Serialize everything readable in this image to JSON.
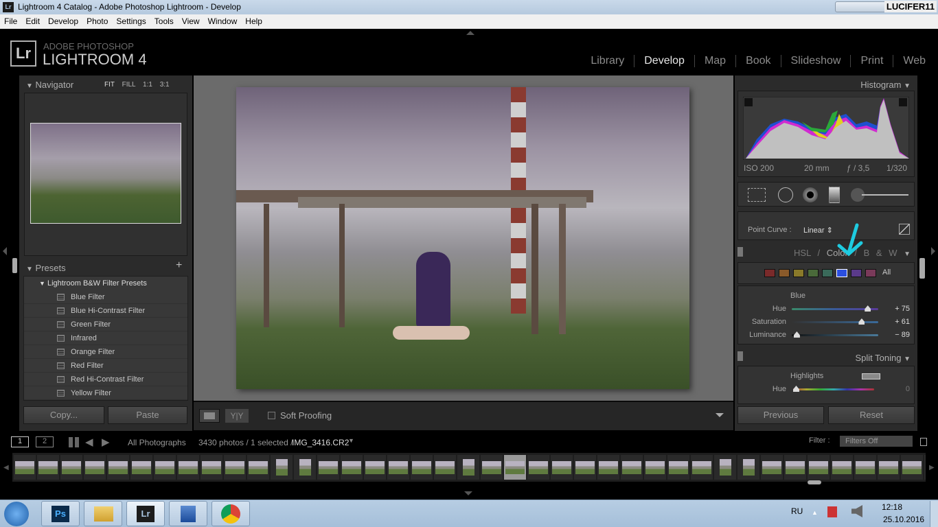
{
  "window": {
    "title": "Lightroom 4 Catalog - Adobe Photoshop Lightroom - Develop",
    "app_icon": "Lr",
    "user": "LUCIFER11"
  },
  "menu": [
    "File",
    "Edit",
    "Develop",
    "Photo",
    "Settings",
    "Tools",
    "View",
    "Window",
    "Help"
  ],
  "brand": {
    "logo": "Lr",
    "line1": "ADOBE PHOTOSHOP",
    "line2": "LIGHTROOM 4"
  },
  "modules": [
    {
      "label": "Library"
    },
    {
      "label": "Develop",
      "active": true
    },
    {
      "label": "Map"
    },
    {
      "label": "Book"
    },
    {
      "label": "Slideshow"
    },
    {
      "label": "Print"
    },
    {
      "label": "Web"
    }
  ],
  "navigator": {
    "title": "Navigator",
    "zoom": [
      "FIT",
      "FILL",
      "1:1",
      "3:1"
    ],
    "active_zoom": "FIT"
  },
  "presets": {
    "title": "Presets",
    "add": "+",
    "folder": "Lightroom B&W Filter Presets",
    "items": [
      "Blue Filter",
      "Blue Hi-Contrast Filter",
      "Green Filter",
      "Infrared",
      "Orange Filter",
      "Red Filter",
      "Red Hi-Contrast Filter",
      "Yellow Filter"
    ]
  },
  "left_buttons": {
    "copy": "Copy...",
    "paste": "Paste"
  },
  "toolbar": {
    "soft_proofing": "Soft Proofing",
    "soft_proofing_checked": false
  },
  "histogram": {
    "title": "Histogram",
    "iso": "ISO 200",
    "focal": "20 mm",
    "aperture": "ƒ / 3,5",
    "shutter": "1/320"
  },
  "tone_curve": {
    "label": "Point Curve :",
    "value": "Linear"
  },
  "hsl": {
    "tabs": [
      "HSL",
      "Color",
      "B & W"
    ],
    "active_tab": "Color",
    "swatches": [
      "#7a2a2a",
      "#8a5a2a",
      "#8a7a2a",
      "#4a6a3a",
      "#3a6a5a",
      "#2b4fe0",
      "#5a3a8a",
      "#7a3a5a"
    ],
    "selected_swatch": 5,
    "all": "All",
    "color_name": "Blue",
    "sliders": [
      {
        "label": "Hue",
        "value": "+ 75",
        "num": 75
      },
      {
        "label": "Saturation",
        "value": "+ 61",
        "num": 61
      },
      {
        "label": "Luminance",
        "value": "− 89",
        "num": -89
      }
    ]
  },
  "split_toning": {
    "title": "Split Toning",
    "highlights": "Highlights",
    "hue_label": "Hue",
    "hue_value": "0"
  },
  "right_buttons": {
    "previous": "Previous",
    "reset": "Reset"
  },
  "filmbar": {
    "view1": "1",
    "view2": "2",
    "source": "All Photographs",
    "count": "3430 photos / 1 selected /",
    "filename": "IMG_3416.CR2",
    "filter_label": "Filter :",
    "filter_value": "Filters Off"
  },
  "taskbar": {
    "lang": "RU",
    "time": "12:18",
    "date": "25.10.2016",
    "apps": [
      "Ps",
      "Explorer",
      "Lr",
      "Network",
      "Chrome"
    ]
  },
  "colors": {
    "accent_arrow": "#1ecbe0",
    "panel": "#2b2b2b"
  }
}
